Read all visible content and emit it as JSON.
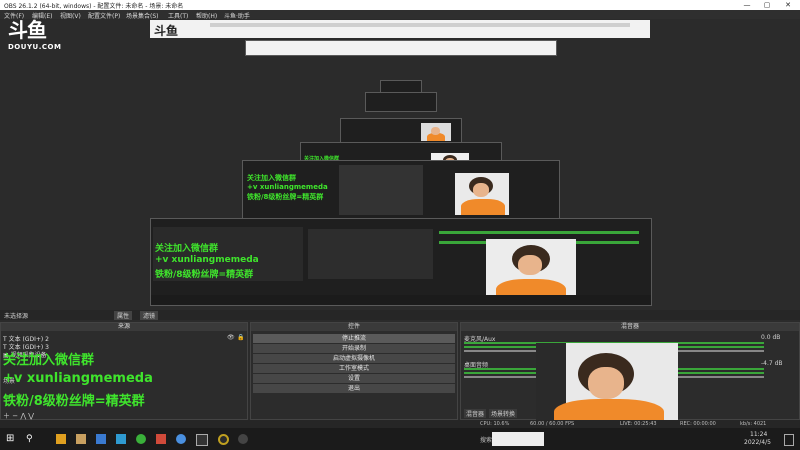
{
  "window": {
    "title": "OBS 26.1.2 (64-bit, windows) - 配置文件: 未命名 - 场景: 未命名",
    "min": "—",
    "max": "▢",
    "close": "✕"
  },
  "menu": [
    "文件(F)",
    "编辑(E)",
    "视图(V)",
    "配置文件(P)",
    "场景集合(S)",
    "工具(T)",
    "帮助(H)",
    "斗鱼·助手"
  ],
  "watermark": {
    "logo": "斗鱼",
    "domain": "DOUYU.COM"
  },
  "preview_label": "未选择源",
  "properties_btn": "属性",
  "filters_btn": "滤镜",
  "panels": {
    "sources": "来源",
    "controls": "控件",
    "mixer": "混音器"
  },
  "sources": [
    {
      "name": "文本 (GDI+) 2"
    },
    {
      "name": "文本 (GDI+) 3"
    },
    {
      "name": "视频采集设备"
    }
  ],
  "overlay_text": {
    "line1": "关注加入微信群",
    "line2": "+v xunliangmemeda",
    "line3": "铁粉/8级粉丝牌=精英群"
  },
  "scene_list": {
    "item1": "场景"
  },
  "controls": [
    "停止推流",
    "开始录制",
    "启动虚拟摄像机",
    "工作室模式",
    "设置",
    "退出"
  ],
  "mixer": {
    "track1": {
      "name": "麦克风/Aux",
      "db": "0.0 dB"
    },
    "track2": {
      "name": "桌面音频",
      "db": "-4.7 dB"
    },
    "tabs": [
      "混音器",
      "场景转换"
    ]
  },
  "status": {
    "fps": "60.00 / 60.00 FPS",
    "cpu": "CPU: 10.6%",
    "live": "LIVE: 00:25:43",
    "rec": "REC: 00:00:00",
    "kbps": "kb/s: 4021"
  },
  "taskbar": {
    "search_label": "搜索",
    "time": "11:24",
    "date": "2022/4/5"
  },
  "colors": {
    "accent_green": "#3fe52c",
    "meter_green": "#3aa63a",
    "meter_yellow": "#c8c83a",
    "meter_red": "#c83a3a",
    "shirt": "#f08a2a"
  }
}
